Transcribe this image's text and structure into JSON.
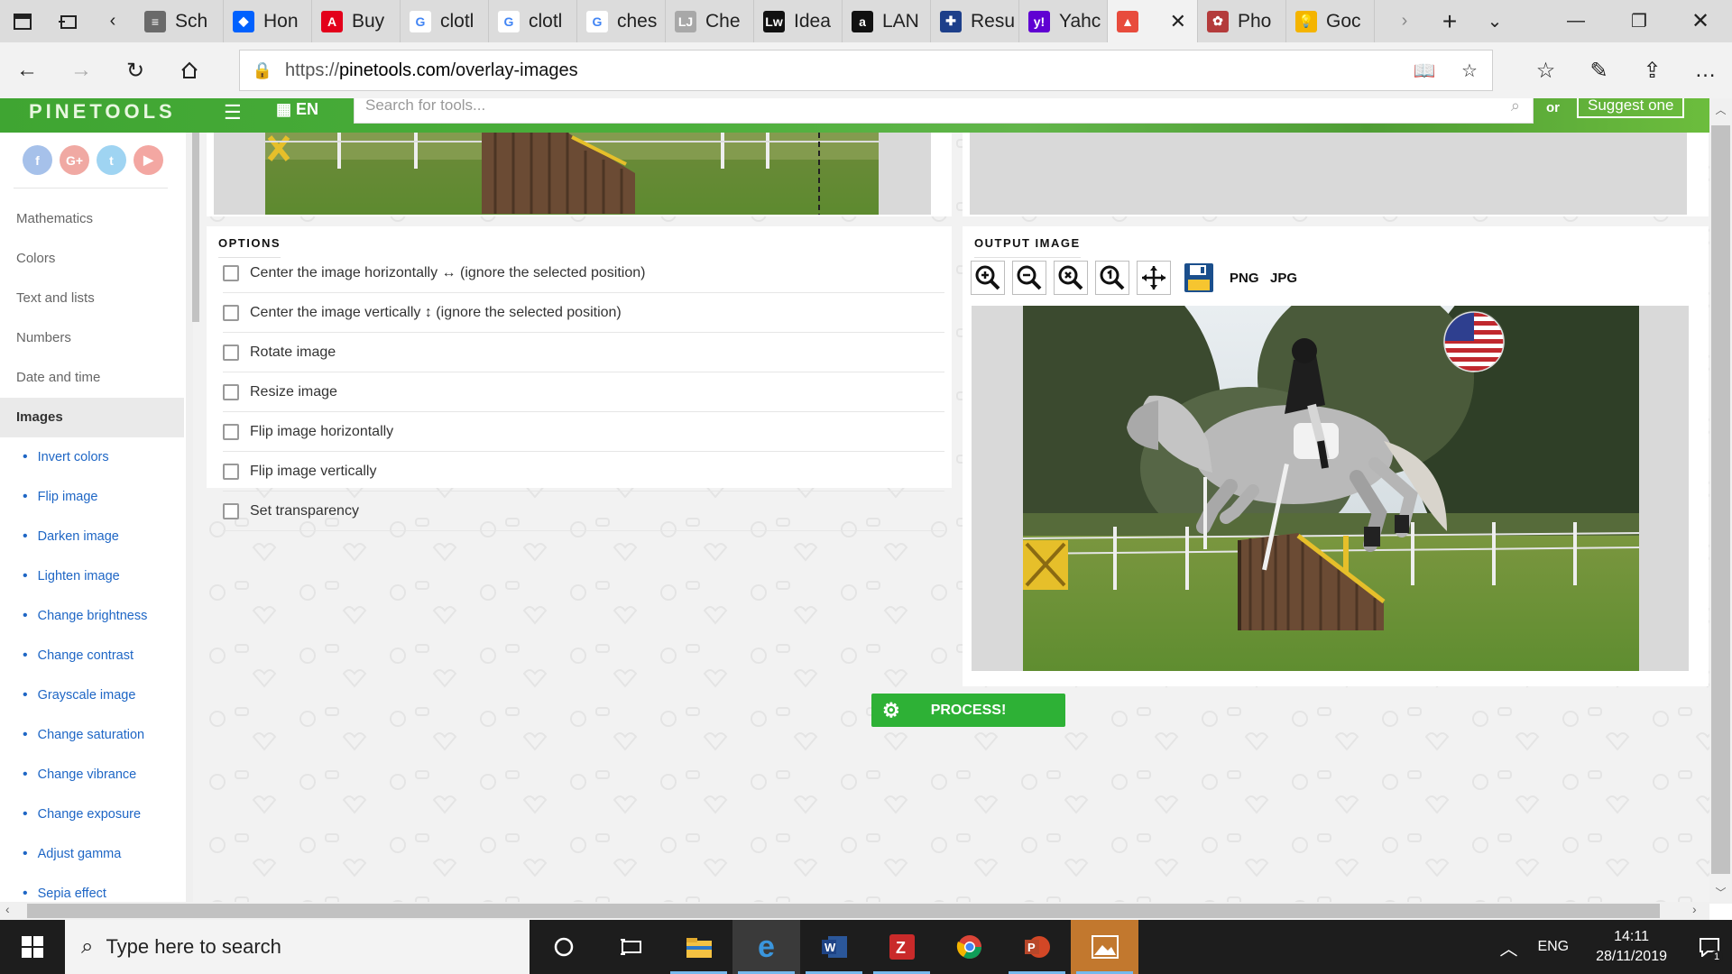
{
  "browser": {
    "tabs": [
      {
        "label": "Sch",
        "fav_color": "#6a6a6a",
        "fav_text": "≡"
      },
      {
        "label": "Hon",
        "fav_color": "#0061fe",
        "fav_text": "◆"
      },
      {
        "label": "Buy",
        "fav_color": "#e3001b",
        "fav_text": "A"
      },
      {
        "label": "clotl",
        "fav_color": "#ffffff",
        "fav_text": "G"
      },
      {
        "label": "clotl",
        "fav_color": "#ffffff",
        "fav_text": "G"
      },
      {
        "label": "ches",
        "fav_color": "#ffffff",
        "fav_text": "G"
      },
      {
        "label": "Che",
        "fav_color": "#a8a8a8",
        "fav_text": "LJ"
      },
      {
        "label": "Idea",
        "fav_color": "#111111",
        "fav_text": "Lw"
      },
      {
        "label": "LAN",
        "fav_color": "#111111",
        "fav_text": "a"
      },
      {
        "label": "Resu",
        "fav_color": "#1d3f8a",
        "fav_text": "✚"
      },
      {
        "label": "Yahc",
        "fav_color": "#6001d2",
        "fav_text": "y!"
      },
      {
        "label": "",
        "fav_color": "#e84c3d",
        "fav_text": "▲",
        "active": true
      },
      {
        "label": "Pho",
        "fav_color": "#b43b3b",
        "fav_text": "✿"
      },
      {
        "label": "Goc",
        "fav_color": "#f4b400",
        "fav_text": "💡"
      }
    ],
    "url_scheme": "https://",
    "url_host": "pinetools.com",
    "url_path": "/overlay-images"
  },
  "site": {
    "logo": "PINETOOLS",
    "lang": "EN",
    "search_placeholder": "Search for tools...",
    "or_text": "or",
    "suggest_label": "Suggest one"
  },
  "sidebar": {
    "categories": [
      "Mathematics",
      "Colors",
      "Text and lists",
      "Numbers",
      "Date and time"
    ],
    "active_category": "Images",
    "image_tools": [
      "Invert colors",
      "Flip image",
      "Darken image",
      "Lighten image",
      "Change brightness",
      "Change contrast",
      "Grayscale image",
      "Change saturation",
      "Change vibrance",
      "Change exposure",
      "Adjust gamma",
      "Sepia effect"
    ]
  },
  "options": {
    "title": "OPTIONS",
    "items": [
      "Center the image horizontally ↔ (ignore the selected position)",
      "Center the image vertically ↕ (ignore the selected position)",
      "Rotate image",
      "Resize image",
      "Flip image horizontally",
      "Flip image vertically",
      "Set transparency"
    ]
  },
  "output": {
    "title": "OUTPUT IMAGE",
    "png_label": "PNG",
    "jpg_label": "JPG"
  },
  "process_label": "PROCESS!",
  "taskbar": {
    "search_placeholder": "Type here to search",
    "lang": "ENG",
    "time": "14:11",
    "date": "28/11/2019",
    "notification_count": "1"
  },
  "colors": {
    "accent_green": "#2eb136",
    "link_blue": "#1e66c5"
  }
}
